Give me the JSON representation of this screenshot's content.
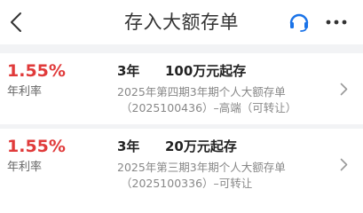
{
  "header": {
    "title": "存入大额存单"
  },
  "products": [
    {
      "rate": "1.55%",
      "rate_label": "年利率",
      "term": "3年",
      "min_amount": "100万元起存",
      "name": "2025年第四期3年期个人大额存单",
      "code": "（2025100436）–高端（可转让）"
    },
    {
      "rate": "1.55%",
      "rate_label": "年利率",
      "term": "3年",
      "min_amount": "20万元起存",
      "name": "2025年第三期3年期个人大额存单",
      "code": "（2025100336）–可转让"
    }
  ],
  "icons": {
    "back": "chevron-left-icon",
    "support": "headset-icon",
    "more": "more-dots-icon",
    "row_arrow": "chevron-right-icon"
  },
  "colors": {
    "rate": "#e03a3a",
    "support_icon": "#1a73e8",
    "page_background": "#f2f3f5"
  }
}
